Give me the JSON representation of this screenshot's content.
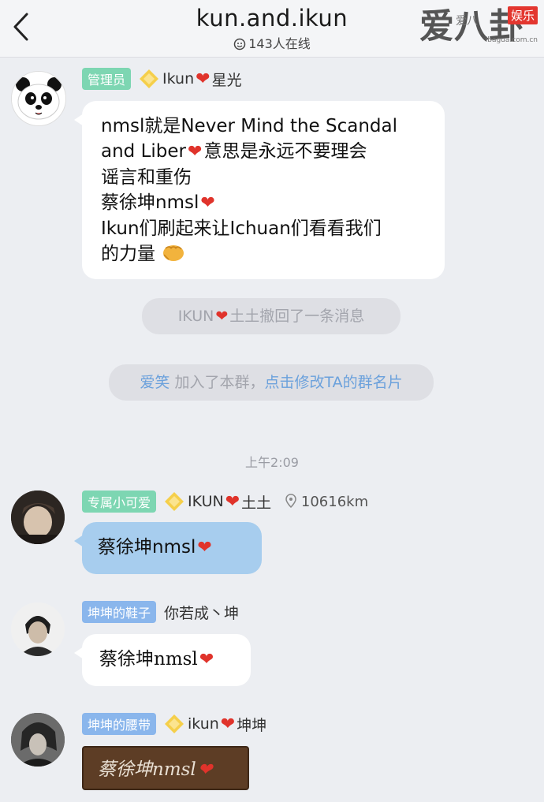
{
  "header": {
    "back_icon": "chevron-left-icon",
    "title": "kun.and.ikun",
    "online": "143人在线"
  },
  "watermark": {
    "main": "爱八卦",
    "badge": "娱乐",
    "small": "爱八",
    "sub": "ibagua.com.cn"
  },
  "messages": [
    {
      "tag": "管理员",
      "name_prefix": "Ikun",
      "name_suffix": "星光",
      "lines": [
        "nmsl就是Never Mind the Scandal",
        "and Liber",
        "意思是永远不要理会",
        "谣言和重伤",
        "蔡徐坤nmsl",
        "Ikun们刷起来让Ichuan们看看我们",
        "的力量"
      ]
    },
    {
      "tag": "专属小可爱",
      "name_prefix": "IKUN",
      "name_suffix": "土土",
      "location": "10616km",
      "text": "蔡徐坤nmsl"
    },
    {
      "tag": "坤坤的鞋子",
      "name": "你若成丶坤",
      "text": "蔡徐坤nmsl"
    },
    {
      "tag": "坤坤的腰带",
      "name_prefix": "ikun",
      "name_suffix": "坤坤",
      "text": "蔡徐坤nmsl"
    }
  ],
  "system": {
    "recall_prefix": "IKUN",
    "recall_suffix": "土土撤回了一条消息",
    "join_name": "爱笑",
    "join_text": "加入了本群，",
    "join_link": "点击修改TA的群名片",
    "time": "上午2:09"
  },
  "colors": {
    "heart": "#e0332b",
    "tag_green": "#7dd6b2",
    "tag_blue": "#8ab6ec",
    "link": "#6ba1dc"
  }
}
